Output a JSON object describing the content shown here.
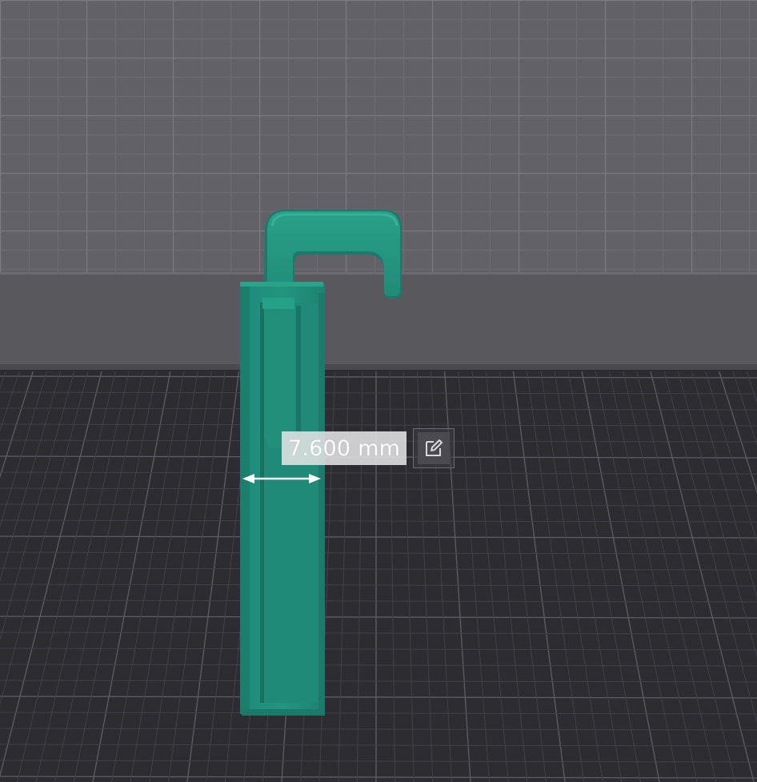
{
  "viewport": {
    "measurement": {
      "value": "7.600 mm"
    },
    "edit_button": {
      "icon": "pencil-edit-icon"
    },
    "colors": {
      "model": "#21917e",
      "background_far": "#616167",
      "platform_edge": "#57575c",
      "plate": "#2c2c31",
      "grid_line": "#6c6c72"
    }
  }
}
